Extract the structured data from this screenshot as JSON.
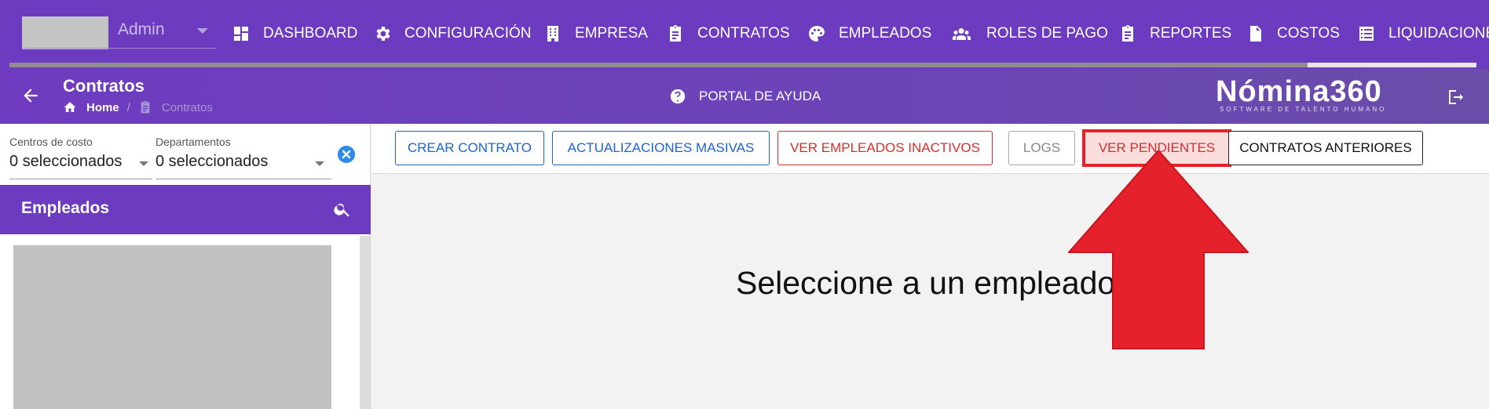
{
  "topnav": {
    "user": {
      "name": "Admin"
    },
    "items": [
      {
        "label": "DASHBOARD",
        "icon": "dashboard-icon"
      },
      {
        "label": "CONFIGURACIÓN",
        "icon": "gear-icon"
      },
      {
        "label": "EMPRESA",
        "icon": "building-icon"
      },
      {
        "label": "CONTRATOS",
        "icon": "clipboard-icon"
      },
      {
        "label": "EMPLEADOS",
        "icon": "palette-icon"
      },
      {
        "label": "ROLES DE PAGO",
        "icon": "group-icon"
      },
      {
        "label": "REPORTES",
        "icon": "clipboard-icon"
      },
      {
        "label": "COSTOS",
        "icon": "invoice-icon"
      },
      {
        "label": "LIQUIDACIONE",
        "icon": "list-icon"
      }
    ]
  },
  "header": {
    "title": "Contratos",
    "breadcrumb": {
      "home": "Home",
      "current": "Contratos"
    },
    "help": "PORTAL DE AYUDA",
    "brand": "Nómina360",
    "brand_sub": "SOFTWARE DE TALENTO HUMANO"
  },
  "filters": {
    "centros_label": "Centros de costo",
    "centros_value": "0 seleccionados",
    "depto_label": "Departamentos",
    "depto_value": "0 seleccionados"
  },
  "employees": {
    "title": "Empleados"
  },
  "toolbar": {
    "crear": "CREAR CONTRATO",
    "actualizaciones": "ACTUALIZACIONES MASIVAS",
    "inactivos": "VER EMPLEADOS INACTIVOS",
    "logs": "LOGS",
    "pendientes": "VER PENDIENTES",
    "anteriores": "CONTRATOS ANTERIORES"
  },
  "main": {
    "message": "Seleccione a un empleado"
  },
  "colors": {
    "primary": "#6d3bbf",
    "accent_blue": "#1e64d0",
    "danger": "#d32f2f",
    "highlight_arrow": "#e5212b"
  }
}
